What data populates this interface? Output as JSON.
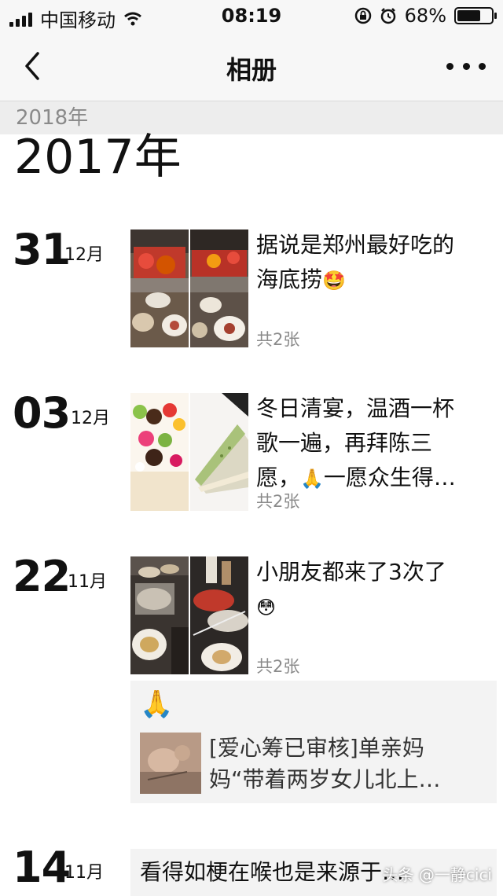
{
  "status_bar": {
    "carrier": "中国移动",
    "time": "08:19",
    "battery_percent": "68%",
    "battery_level": 0.68
  },
  "nav": {
    "title": "相册"
  },
  "sticky_year": "2018年",
  "year_heading": "2017年",
  "entries": [
    {
      "day": "31",
      "month": "12月",
      "text_line1": "据说是郑州最好吃的",
      "text_line2": "海底捞",
      "emoji": "🤩",
      "count": "共2张"
    },
    {
      "day": "03",
      "month": "12月",
      "text_line1": "冬日清宴，温酒一杯",
      "text_line2": "歌一遍，再拜陈三",
      "text_line3": "愿，",
      "emoji": "🙏",
      "text_line3_tail": "一愿众生得…",
      "count": "共2张"
    },
    {
      "day": "22",
      "month": "11月",
      "text_line1": "小朋友都来了3次了",
      "emoji": "😳",
      "count": "共2张",
      "share": {
        "emoji": "🙏",
        "title_line1": "[爱心筹已审核]单亲妈",
        "title_line2": "妈“带着两岁女儿北上…"
      }
    },
    {
      "day": "14",
      "month": "11月",
      "quote": "看得如梗在喉也是来源于…"
    }
  ],
  "watermark": "头条 @一静cici",
  "icons": {
    "back": "chevron-left-icon",
    "more": "more-dots-icon",
    "wifi": "wifi-icon",
    "lock": "rotation-lock-icon",
    "alarm": "alarm-icon",
    "battery": "battery-icon"
  }
}
